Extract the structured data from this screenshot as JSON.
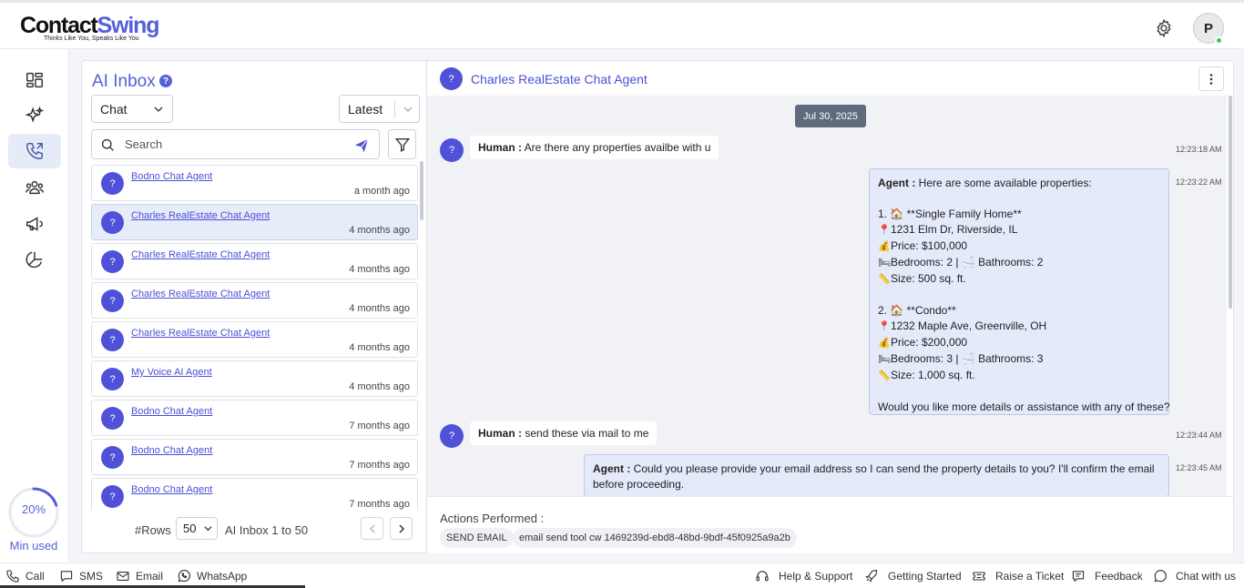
{
  "brand": {
    "name_part1": "Contact",
    "name_part2": "Swing",
    "tagline": "Thinks Like You, Speaks Like You"
  },
  "header": {
    "avatar_initial": "P"
  },
  "sidebar": {
    "items": [
      {
        "icon": "dashboard-icon"
      },
      {
        "icon": "sparkles-icon"
      },
      {
        "icon": "phone-calls-icon",
        "active": true
      },
      {
        "icon": "users-icon"
      },
      {
        "icon": "megaphone-icon"
      },
      {
        "icon": "pie-chart-icon"
      }
    ],
    "usage": {
      "percent_label": "20%",
      "percent": 0.2,
      "caption": "Min used"
    }
  },
  "inbox": {
    "title": "AI Inbox",
    "channel_select": "Chat",
    "sort_select": "Latest",
    "search_placeholder": "Search",
    "conversations": [
      {
        "name": "Bodno Chat Agent",
        "time": "a month ago"
      },
      {
        "name": "Charles RealEstate Chat Agent",
        "time": "4 months ago",
        "selected": true
      },
      {
        "name": "Charles RealEstate Chat Agent",
        "time": "4 months ago"
      },
      {
        "name": "Charles RealEstate Chat Agent",
        "time": "4 months ago"
      },
      {
        "name": "Charles RealEstate Chat Agent",
        "time": "4 months ago"
      },
      {
        "name": "My Voice AI Agent",
        "time": "4 months ago"
      },
      {
        "name": "Bodno Chat Agent",
        "time": "7 months ago"
      },
      {
        "name": "Bodno Chat Agent",
        "time": "7 months ago"
      },
      {
        "name": "Bodno Chat Agent",
        "time": "7 months ago"
      }
    ],
    "avatar_glyph": "?",
    "pager": {
      "rows_label": "#Rows",
      "rows_value": "50",
      "range": "AI Inbox 1 to 50"
    }
  },
  "chat": {
    "title": "Charles RealEstate Chat Agent",
    "date": "Jul 30, 2025",
    "messages": {
      "m1": {
        "speaker": "Human :",
        "text": "Are there any properties availbe with u",
        "time": "12:23:18 AM"
      },
      "m2": {
        "speaker": "Agent :",
        "time": "12:23:22 AM",
        "intro": "Here are some available properties:",
        "p1_title": "1. 🏠 **Single Family Home**",
        "p1_addr": "1231 Elm Dr, Riverside, IL",
        "p1_price": "Price: $100,000",
        "p1_beds": "Bedrooms: 2 | 🛁 Bathrooms: 2",
        "p1_size": "Size: 500 sq. ft.",
        "p2_title": "2. 🏠 **Condo**",
        "p2_addr": "1232 Maple Ave, Greenville, OH",
        "p2_price": "Price: $200,000",
        "p2_beds": "Bedrooms: 3 | 🛁 Bathrooms: 3",
        "p2_size": "Size: 1,000 sq. ft.",
        "outro": "Would you like more details or assistance with any of these?"
      },
      "m3": {
        "speaker": "Human :",
        "text": "send these via mail to me",
        "time": "12:23:44 AM"
      },
      "m4": {
        "speaker": "Agent :",
        "text_line1": "Could you please provide your email address so I can send the property details to you? I'll confirm the email",
        "text_line2": "before proceeding.",
        "time": "12:23:45 AM"
      }
    },
    "actions_label": "Actions Performed :",
    "actions": [
      "SEND EMAIL",
      "email send tool cw 1469239d-ebd8-48bd-9bdf-45f0925a9a2b"
    ]
  },
  "footer": {
    "left": [
      "Call",
      "SMS",
      "Email",
      "WhatsApp"
    ],
    "right": [
      "Help & Support",
      "Getting Started",
      "Raise a Ticket",
      "Feedback",
      "Chat with us"
    ]
  },
  "colors": {
    "accent": "#5561d6",
    "avatar": "#4f52d8",
    "agent_bubble": "#e4eafa",
    "chat_bg": "#f1f2f6"
  }
}
